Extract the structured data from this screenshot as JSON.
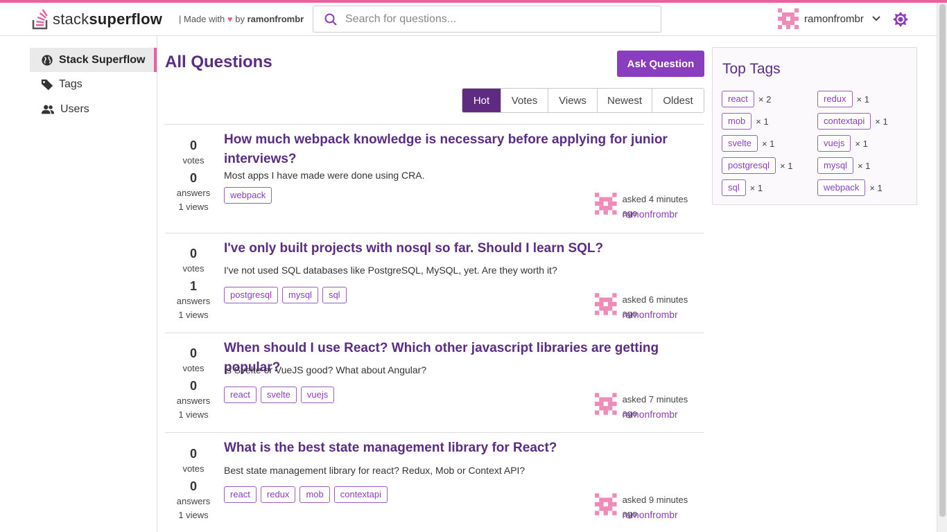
{
  "header": {
    "logo_prefix": "stack",
    "logo_bold": "superflow",
    "made_with": "| Made with",
    "heart": "♥",
    "by": "by",
    "author": "ramonfrombr",
    "search_placeholder": "Search for questions...",
    "user_name": "ramonfrombr"
  },
  "sidebar": {
    "items": [
      {
        "label": "Stack Superflow",
        "icon": "globe-icon",
        "active": true
      },
      {
        "label": "Tags",
        "icon": "tag-icon",
        "active": false
      },
      {
        "label": "Users",
        "icon": "users-icon",
        "active": false
      }
    ]
  },
  "main": {
    "title": "All Questions",
    "ask_button": "Ask Question",
    "sort_tabs": [
      "Hot",
      "Votes",
      "Views",
      "Newest",
      "Oldest"
    ],
    "active_sort": "Hot",
    "questions": [
      {
        "votes": "0",
        "votes_label": "votes",
        "answers": "0",
        "answers_label": "answers",
        "views": "1 views",
        "title": "How much webpack knowledge is necessary before applying for junior interviews?",
        "body": "Most apps I have made were done using CRA.",
        "tags": [
          "webpack"
        ],
        "asked": "asked 4 minutes ago",
        "author": "ramonfrombr"
      },
      {
        "votes": "0",
        "votes_label": "votes",
        "answers": "1",
        "answers_label": "answers",
        "views": "1 views",
        "title": "I've only built projects with nosql so far. Should I learn SQL?",
        "body": "I've not used SQL databases like PostgreSQL, MySQL, yet. Are they worth it?",
        "tags": [
          "postgresql",
          "mysql",
          "sql"
        ],
        "asked": "asked 6 minutes ago",
        "author": "ramonfrombr"
      },
      {
        "votes": "0",
        "votes_label": "votes",
        "answers": "0",
        "answers_label": "answers",
        "views": "1 views",
        "title": "When should I use React? Which other javascript libraries are getting popular?",
        "body": "Is Svelte or VueJS good? What about Angular?",
        "tags": [
          "react",
          "svelte",
          "vuejs"
        ],
        "asked": "asked 7 minutes ago",
        "author": "ramonfrombr"
      },
      {
        "votes": "0",
        "votes_label": "votes",
        "answers": "0",
        "answers_label": "answers",
        "views": "1 views",
        "title": "What is the best state management library for React?",
        "body": "Best state management library for react? Redux, Mob or Context API?",
        "tags": [
          "react",
          "redux",
          "mob",
          "contextapi"
        ],
        "asked": "asked 9 minutes ago",
        "author": "ramonfrombr"
      }
    ]
  },
  "top_tags": {
    "title": "Top Tags",
    "tags": [
      {
        "name": "react",
        "count": "× 2"
      },
      {
        "name": "redux",
        "count": "× 1"
      },
      {
        "name": "mob",
        "count": "× 1"
      },
      {
        "name": "contextapi",
        "count": "× 1"
      },
      {
        "name": "svelte",
        "count": "× 1"
      },
      {
        "name": "vuejs",
        "count": "× 1"
      },
      {
        "name": "postgresql",
        "count": "× 1"
      },
      {
        "name": "mysql",
        "count": "× 1"
      },
      {
        "name": "sql",
        "count": "× 1"
      },
      {
        "name": "webpack",
        "count": "× 1"
      }
    ]
  },
  "colors": {
    "accent": "#e8639e",
    "primary": "#8a3dbf",
    "title": "#5a2d84"
  }
}
